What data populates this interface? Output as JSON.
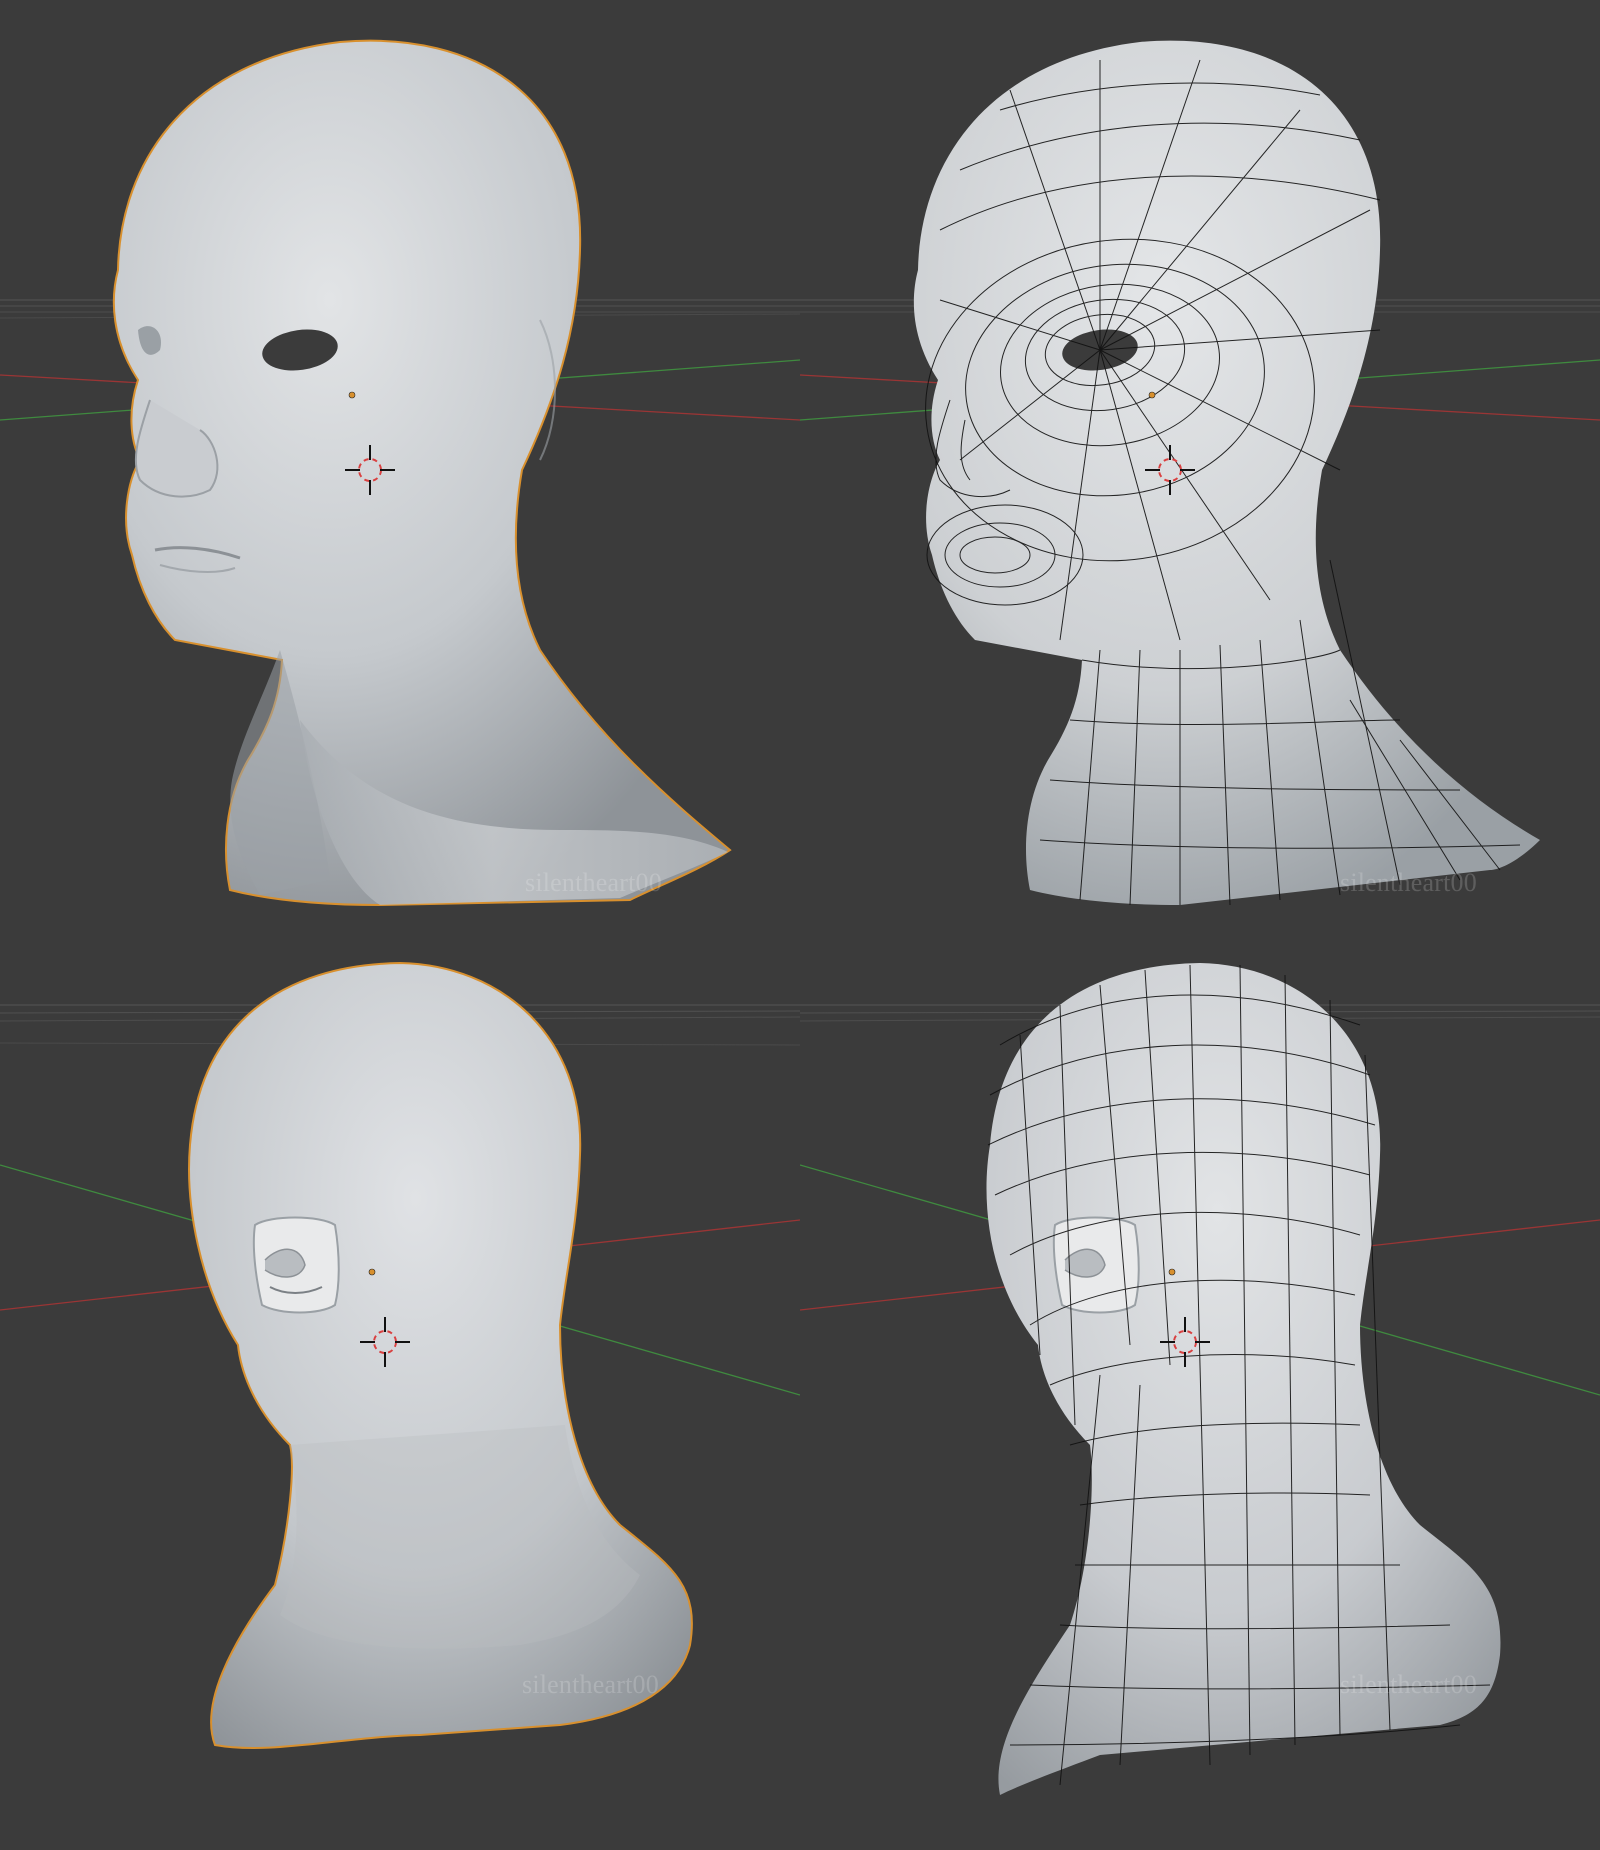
{
  "scene": {
    "watermarks": {
      "front_smooth": "silentheart00",
      "front_wire": "silentheart00",
      "back_smooth": "silentheart00",
      "back_wire": "silentheart00"
    },
    "colors": {
      "background": "#3b3b3b",
      "mesh_light": "#d7d9dc",
      "mesh_shadow": "#8c9196",
      "selection_outline": "#d8902e",
      "wireframe": "#101010",
      "axis_x": "#b83a3a",
      "axis_y": "#3f9b3f",
      "grid_line": "#575757",
      "cursor_red": "#d94040"
    },
    "icons": {
      "cursor": "3d-cursor-icon",
      "origin": "object-origin-icon"
    }
  }
}
